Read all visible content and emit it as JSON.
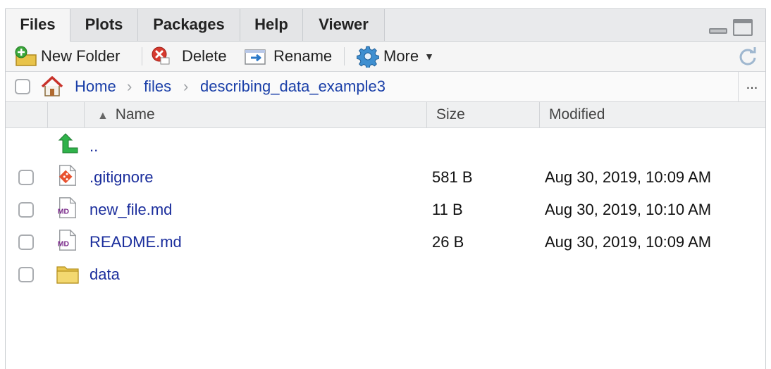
{
  "tabs": [
    {
      "label": "Files",
      "active": true
    },
    {
      "label": "Plots",
      "active": false
    },
    {
      "label": "Packages",
      "active": false
    },
    {
      "label": "Help",
      "active": false
    },
    {
      "label": "Viewer",
      "active": false
    }
  ],
  "toolbar": {
    "new_folder": "New Folder",
    "delete": "Delete",
    "rename": "Rename",
    "more": "More"
  },
  "path": {
    "crumbs": [
      "Home",
      "files",
      "describing_data_example3"
    ],
    "more": "..."
  },
  "columns": {
    "name": "Name",
    "size": "Size",
    "modified": "Modified"
  },
  "parent": {
    "name": ".."
  },
  "files": [
    {
      "name": ".gitignore",
      "size": "581 B",
      "modified": "Aug 30, 2019, 10:09 AM",
      "icon": "git-file-icon"
    },
    {
      "name": "new_file.md",
      "size": "11 B",
      "modified": "Aug 30, 2019, 10:10 AM",
      "icon": "markdown-file-icon"
    },
    {
      "name": "README.md",
      "size": "26 B",
      "modified": "Aug 30, 2019, 10:09 AM",
      "icon": "markdown-file-icon"
    },
    {
      "name": "data",
      "size": "",
      "modified": "",
      "icon": "folder-icon"
    }
  ],
  "colors": {
    "link": "#1a3fa8",
    "file_link": "#1a2d9c",
    "tab_bg": "#e9eaec"
  }
}
